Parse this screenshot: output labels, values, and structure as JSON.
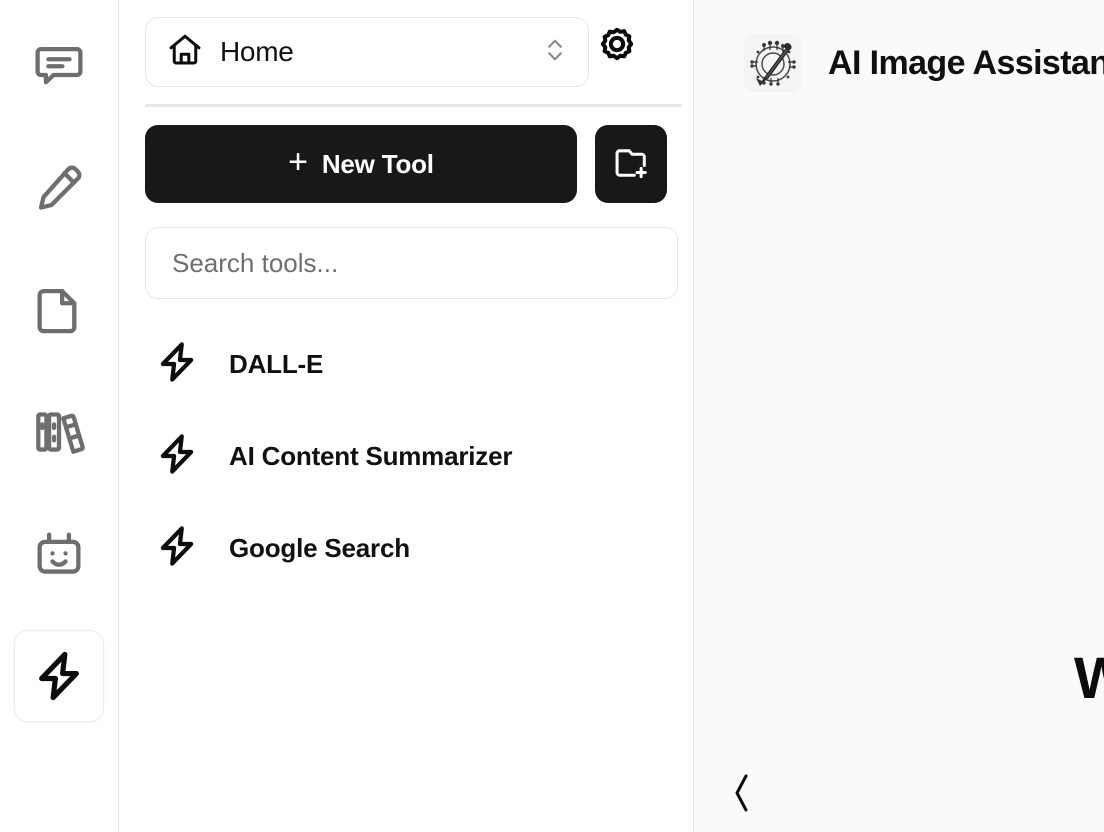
{
  "theme": {
    "accent_dark": "#18181b",
    "panel_bg": "#fafafa",
    "sidebar_bg": "#ffffff",
    "border": "#e6e6e6",
    "muted_icon": "#6e6e6e",
    "text_primary": "#111111",
    "text_placeholder": "#6f6f6f"
  },
  "icon_rail": {
    "items": [
      {
        "name": "chat-icon",
        "label": "Chat",
        "active": false
      },
      {
        "name": "pencil-icon",
        "label": "Write",
        "active": false
      },
      {
        "name": "document-icon",
        "label": "Documents",
        "active": false
      },
      {
        "name": "library-icon",
        "label": "Library",
        "active": false
      },
      {
        "name": "bot-icon",
        "label": "Bots",
        "active": false
      },
      {
        "name": "lightning-icon",
        "label": "Tools",
        "active": true
      }
    ]
  },
  "sidebar": {
    "workspace": {
      "label": "Home",
      "icon": "home-icon",
      "chevron": "chevron-up-down-icon"
    },
    "settings_button": {
      "label": "Settings",
      "icon": "gear-icon"
    },
    "new_tool_button": {
      "label": "New Tool",
      "plus": "+"
    },
    "new_folder_button": {
      "label": "New Folder",
      "icon": "folder-plus-icon"
    },
    "search": {
      "placeholder": "Search tools...",
      "value": ""
    },
    "tools": [
      {
        "label": "DALL-E",
        "icon": "lightning-icon"
      },
      {
        "label": "AI Content Summarizer",
        "icon": "lightning-icon"
      },
      {
        "label": "Google Search",
        "icon": "lightning-icon"
      }
    ]
  },
  "main": {
    "agent": {
      "title": "AI Image Assistant",
      "avatar": "ai-image-assistant-avatar"
    },
    "hero_heading": "Welcome",
    "back_button": {
      "glyph": "‹",
      "label": "Back"
    }
  }
}
